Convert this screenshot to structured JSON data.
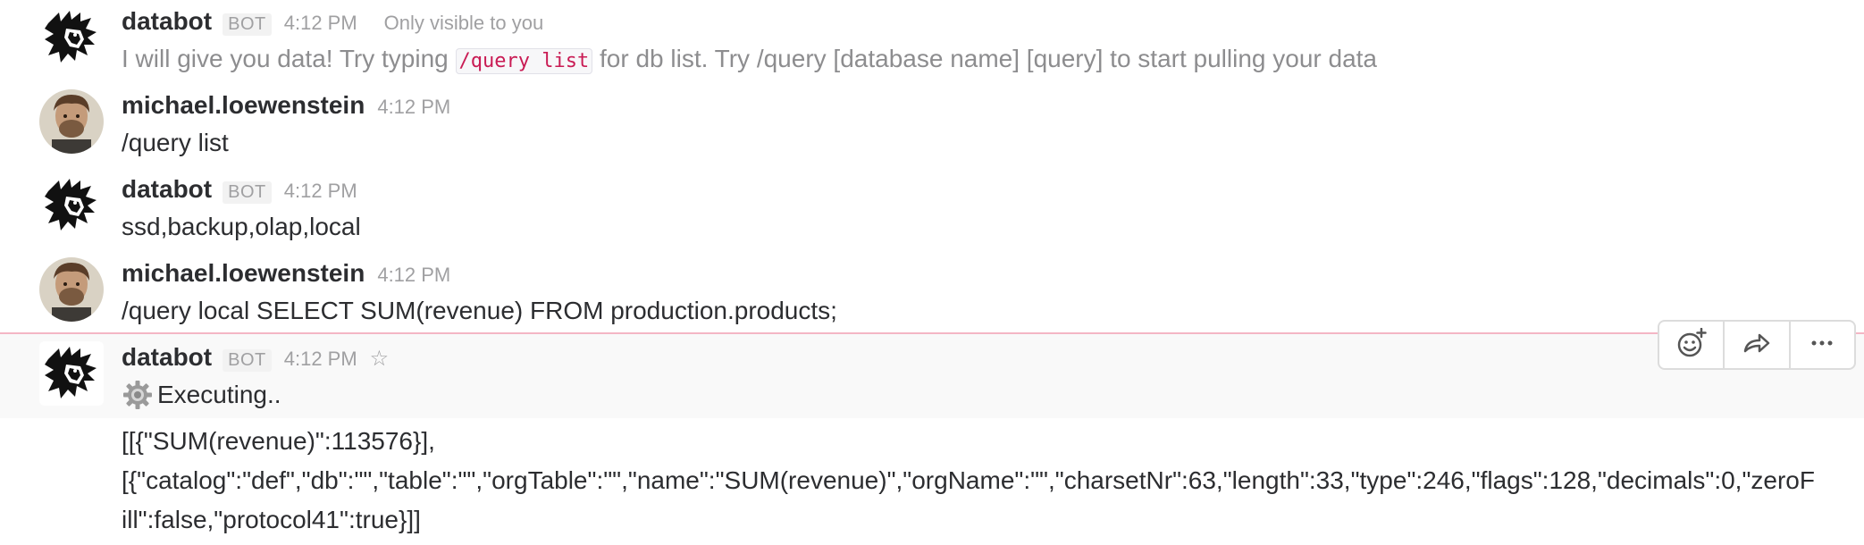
{
  "messages": [
    {
      "sender": "databot",
      "badge": "BOT",
      "time": "4:12 PM",
      "visibility": "Only visible to you",
      "text_before_code": "I will give you data! Try typing ",
      "code": "/query list",
      "text_after_code": " for db list. Try /query [database name] [query] to start pulling your data",
      "avatar_icon": "lion-head-icon"
    },
    {
      "sender": "michael.loewenstein",
      "time": "4:12 PM",
      "text": "/query list",
      "avatar_icon": "user-photo"
    },
    {
      "sender": "databot",
      "badge": "BOT",
      "time": "4:12 PM",
      "text": "ssd,backup,olap,local",
      "avatar_icon": "lion-head-icon"
    },
    {
      "sender": "michael.loewenstein",
      "time": "4:12 PM",
      "text": "/query local SELECT SUM(revenue) FROM production.products;",
      "avatar_icon": "user-photo"
    },
    {
      "sender": "databot",
      "badge": "BOT",
      "time": "4:12 PM",
      "status_text": "Executing..",
      "status_icon": "gear-icon",
      "result_line1": "[[{\"SUM(revenue)\":113576}],",
      "result_line2": "[{\"catalog\":\"def\",\"db\":\"\",\"table\":\"\",\"orgTable\":\"\",\"name\":\"SUM(revenue)\",\"orgName\":\"\",\"charsetNr\":63,\"length\":33,\"type\":246,\"flags\":128,\"decimals\":0,\"zeroFill\":false,\"protocol41\":true}]]",
      "avatar_icon": "lion-head-icon"
    }
  ],
  "hover_actions": {
    "icons": [
      "add-reaction-icon",
      "share-icon",
      "more-actions-icon"
    ]
  },
  "colors": {
    "divider": "#f4b6c4",
    "code_text": "#c91b54",
    "muted": "#a0a0a2"
  }
}
